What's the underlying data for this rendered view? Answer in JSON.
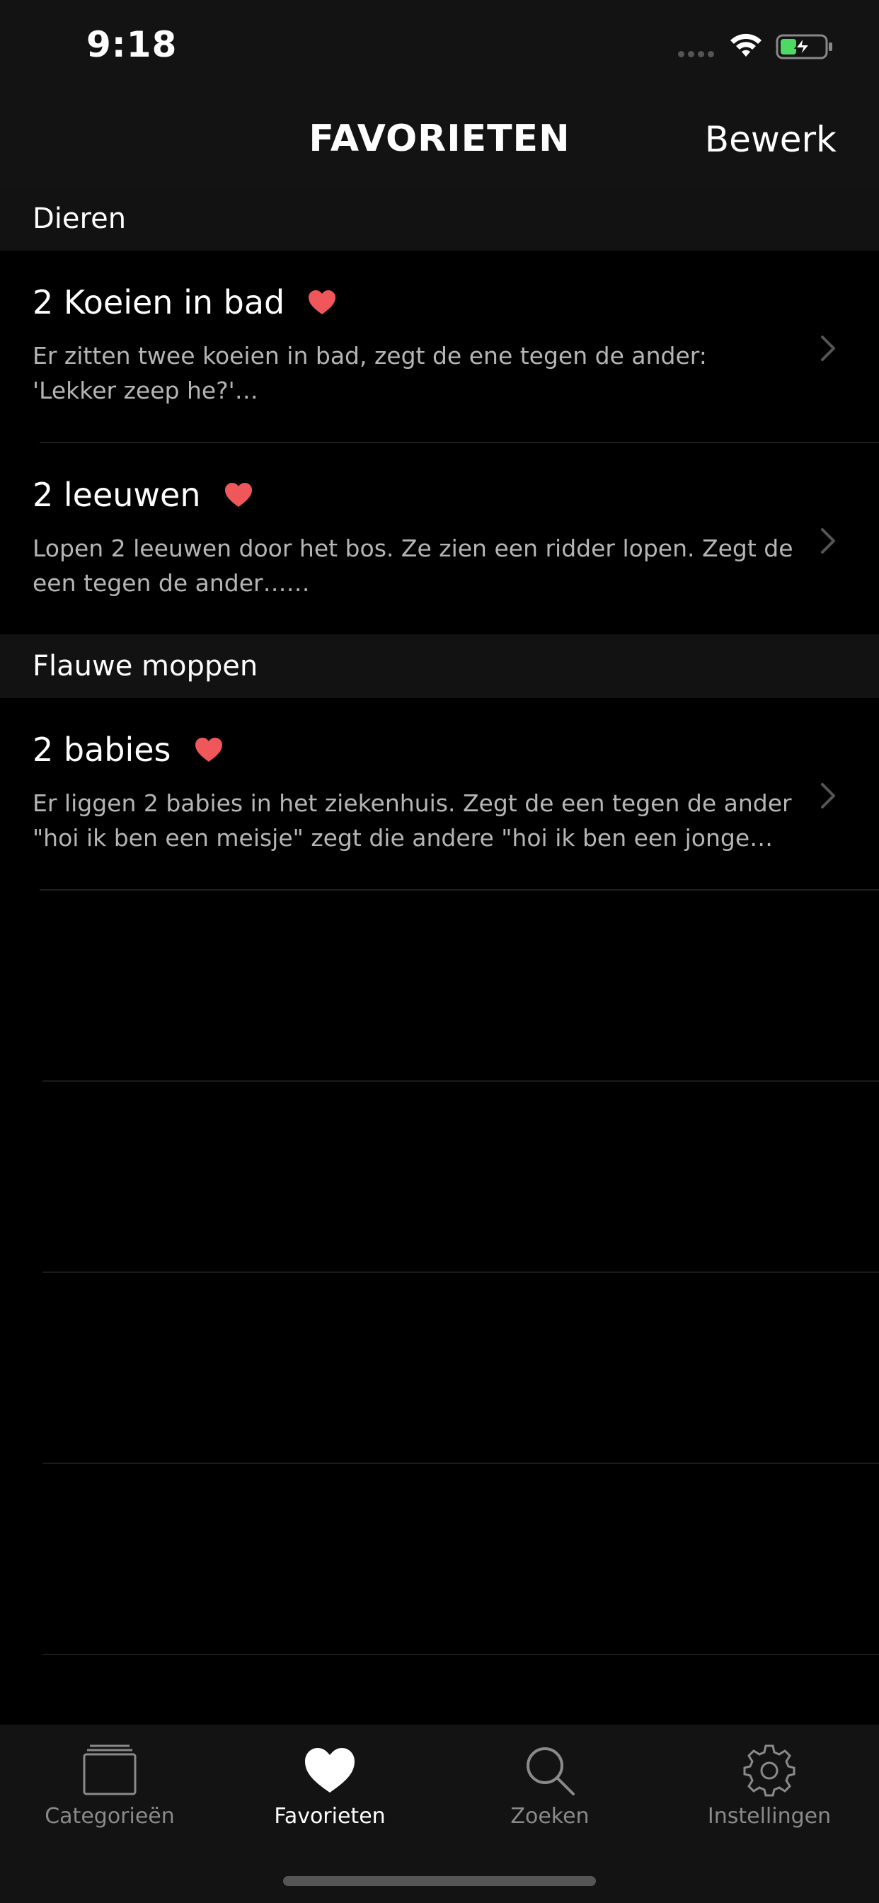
{
  "status": {
    "time": "9:18"
  },
  "nav": {
    "title": "FAVORIETEN",
    "edit_label": "Bewerk"
  },
  "sections": [
    {
      "header": "Dieren",
      "items": [
        {
          "title": "2 Koeien in bad",
          "description": "Er zitten twee koeien in bad, zegt de ene tegen de ander: 'Lekker zeep he?'…",
          "favorite": true
        },
        {
          "title": "2 leeuwen",
          "description": "Lopen 2 leeuwen door het bos. Ze zien een ridder lopen. Zegt de een tegen de ander……",
          "favorite": true
        }
      ]
    },
    {
      "header": "Flauwe moppen",
      "items": [
        {
          "title": "2 babies",
          "description": "Er liggen 2 babies in het ziekenhuis. Zegt de een tegen de ander \"hoi ik ben een meisje\" zegt die andere \"hoi ik ben een jonge…",
          "favorite": true
        }
      ]
    }
  ],
  "tabs": [
    {
      "label": "Categorieën",
      "icon": "stack-icon",
      "active": false
    },
    {
      "label": "Favorieten",
      "icon": "heart-icon",
      "active": true
    },
    {
      "label": "Zoeken",
      "icon": "search-icon",
      "active": false
    },
    {
      "label": "Instellingen",
      "icon": "gear-icon",
      "active": false
    }
  ],
  "colors": {
    "heart": "#f0575b",
    "background": "#000000",
    "bar": "#131313",
    "inactive_tab": "#8a8a8a"
  }
}
